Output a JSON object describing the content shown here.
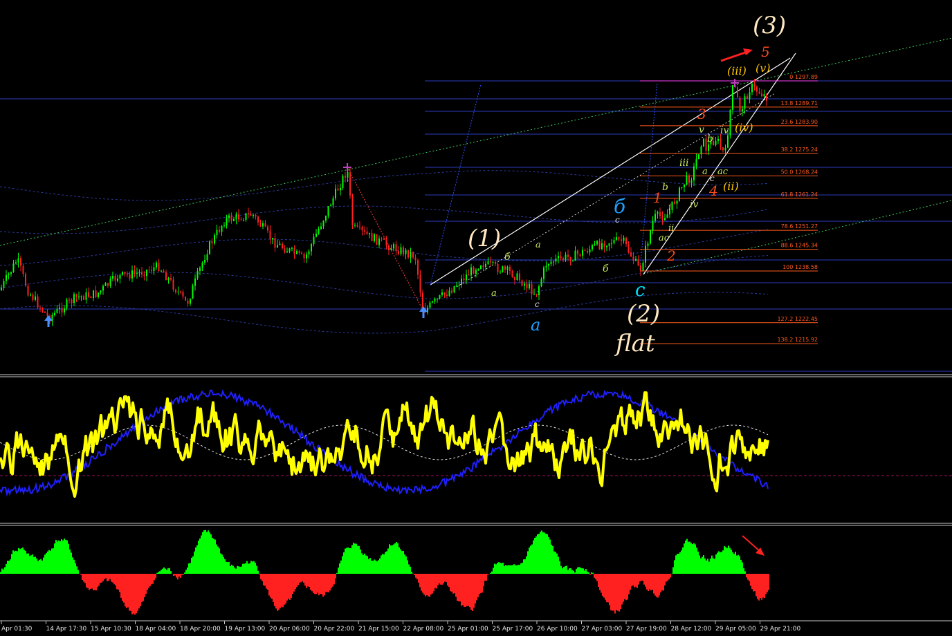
{
  "chart_data": {
    "type": "line",
    "panels": [
      "price",
      "oscillator",
      "histogram"
    ],
    "time_labels": [
      "Apr 01:30",
      "14 Apr 17:30",
      "15 Apr 10:30",
      "18 Apr 04:00",
      "18 Apr 20:00",
      "19 Apr 13:00",
      "20 Apr 06:00",
      "20 Apr 22:00",
      "21 Apr 15:00",
      "22 Apr 08:00",
      "25 Apr 01:00",
      "25 Apr 17:00",
      "26 Apr 10:00",
      "27 Apr 03:00",
      "27 Apr 19:00",
      "28 Apr 12:00",
      "29 Apr 05:00",
      "29 Apr 21:00"
    ],
    "fibonacci_levels": [
      {
        "label": "0 1297.89",
        "ratio": 0,
        "price": 1297.89
      },
      {
        "label": "13.8 1289.71",
        "ratio": 13.8,
        "price": 1289.71
      },
      {
        "label": "23.6 1283.90",
        "ratio": 23.6,
        "price": 1283.9
      },
      {
        "label": "38.2 1275.24",
        "ratio": 38.2,
        "price": 1275.24
      },
      {
        "label": "50.0 1268.24",
        "ratio": 50.0,
        "price": 1268.24
      },
      {
        "label": "61.8 1261.24",
        "ratio": 61.8,
        "price": 1261.24
      },
      {
        "label": "78.6 1251.27",
        "ratio": 78.6,
        "price": 1251.27
      },
      {
        "label": "88.6 1245.34",
        "ratio": 88.6,
        "price": 1245.34
      },
      {
        "label": "100 1238.58",
        "ratio": 100,
        "price": 1238.58
      },
      {
        "label": "127.2 1222.45",
        "ratio": 127.2,
        "price": 1222.45
      },
      {
        "label": "138.2 1215.92",
        "ratio": 138.2,
        "price": 1215.92
      }
    ],
    "wave_labels": {
      "primary": [
        "(1)",
        "(2)",
        "(3)",
        "flat"
      ],
      "abc": [
        "a",
        "б",
        "c"
      ],
      "orange": [
        "1",
        "2",
        "3",
        "4",
        "5"
      ],
      "minor": [
        "(ii)",
        "(iii)",
        "(iv)",
        "(v)"
      ],
      "small": [
        "a",
        "b",
        "c",
        "б",
        "ac",
        "i",
        "ii",
        "iii",
        "iv",
        "v",
        "iv"
      ]
    },
    "colors": {
      "up_candle": "#00ff00",
      "down_candle": "#ff2020",
      "oscillator": "#ffff00",
      "oscillator2": "#2020ff",
      "hist_pos": "#00ff00",
      "hist_neg": "#ff2020",
      "fib": "#ff5a1e",
      "grid_line": "#3c50ff"
    }
  }
}
